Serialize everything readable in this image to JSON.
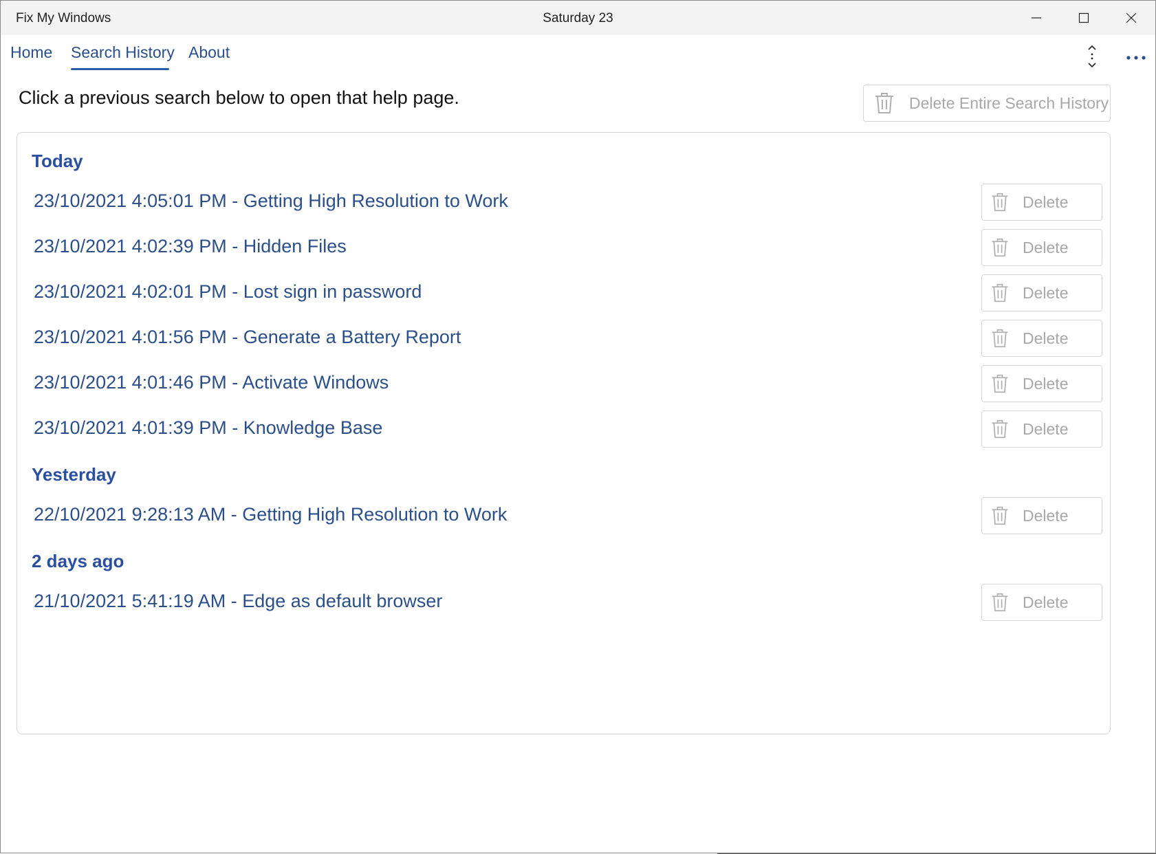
{
  "window": {
    "app_title": "Fix My Windows",
    "center_title": "Saturday 23",
    "caption_buttons": [
      "minimize-icon",
      "maximize-icon",
      "close-icon"
    ]
  },
  "nav": {
    "tabs": [
      {
        "label": "Home",
        "selected": false
      },
      {
        "label": "Search History",
        "selected": true
      },
      {
        "label": "About",
        "selected": false
      }
    ],
    "icons": [
      "sort-icon",
      "more-icon"
    ]
  },
  "main": {
    "instruction": "Click a previous search below to open that help page.",
    "delete_all_label": "Delete Entire Search History"
  },
  "history": {
    "groups": [
      {
        "header": "Today",
        "items": [
          {
            "text": "23/10/2021 4:05:01 PM - Getting High Resolution to Work",
            "delete_label": "Delete"
          },
          {
            "text": "23/10/2021 4:02:39 PM - Hidden Files",
            "delete_label": "Delete"
          },
          {
            "text": "23/10/2021 4:02:01 PM - Lost sign in password",
            "delete_label": "Delete"
          },
          {
            "text": "23/10/2021 4:01:56 PM - Generate a Battery Report",
            "delete_label": "Delete"
          },
          {
            "text": "23/10/2021 4:01:46 PM - Activate Windows",
            "delete_label": "Delete"
          },
          {
            "text": "23/10/2021 4:01:39 PM - Knowledge Base",
            "delete_label": "Delete"
          }
        ]
      },
      {
        "header": "Yesterday",
        "items": [
          {
            "text": "22/10/2021 9:28:13 AM - Getting High Resolution to Work",
            "delete_label": "Delete"
          }
        ]
      },
      {
        "header": "2 days ago",
        "items": [
          {
            "text": "21/10/2021 5:41:19 AM - Edge as default browser",
            "delete_label": "Delete"
          }
        ]
      }
    ]
  },
  "colors": {
    "link": "#2b4f8a",
    "header": "#2b4fa0",
    "disabled_text": "#a8a8a8",
    "accent": "#2b5aa6"
  }
}
